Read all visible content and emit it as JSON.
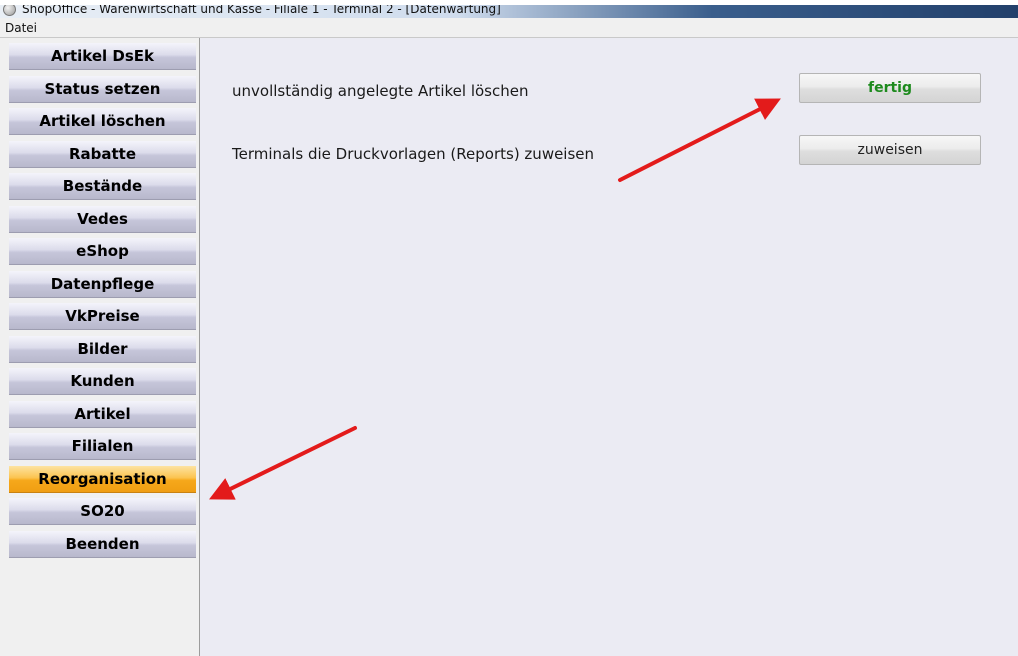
{
  "window": {
    "title": "ShopOffice - Warenwirtschaft und Kasse - Filiale 1 - Terminal 2 - [Datenwartung]"
  },
  "menu": {
    "items": [
      "Datei"
    ]
  },
  "sidebar": {
    "items": [
      {
        "label": "Artikel DsEk",
        "active": false
      },
      {
        "label": "Status setzen",
        "active": false
      },
      {
        "label": "Artikel löschen",
        "active": false
      },
      {
        "label": "Rabatte",
        "active": false
      },
      {
        "label": "Bestände",
        "active": false
      },
      {
        "label": "Vedes",
        "active": false
      },
      {
        "label": "eShop",
        "active": false
      },
      {
        "label": "Datenpflege",
        "active": false
      },
      {
        "label": "VkPreise",
        "active": false
      },
      {
        "label": "Bilder",
        "active": false
      },
      {
        "label": "Kunden",
        "active": false
      },
      {
        "label": "Artikel",
        "active": false
      },
      {
        "label": "Filialen",
        "active": false
      },
      {
        "label": "Reorganisation",
        "active": true
      },
      {
        "label": "SO20",
        "active": false
      },
      {
        "label": "Beenden",
        "active": false
      }
    ]
  },
  "main": {
    "rows": [
      {
        "label": "unvollständig angelegte Artikel löschen",
        "button": "fertig"
      },
      {
        "label": "Terminals die Druckvorlagen (Reports) zuweisen",
        "button": "zuweisen"
      }
    ]
  },
  "colors": {
    "active_nav": "#f6a81b",
    "done_text": "#1d8a1d",
    "annotation_arrow": "#e31b1b"
  },
  "annotations": {
    "arrows": [
      "arrow-to-fertig-button",
      "arrow-to-reorganisation"
    ]
  }
}
